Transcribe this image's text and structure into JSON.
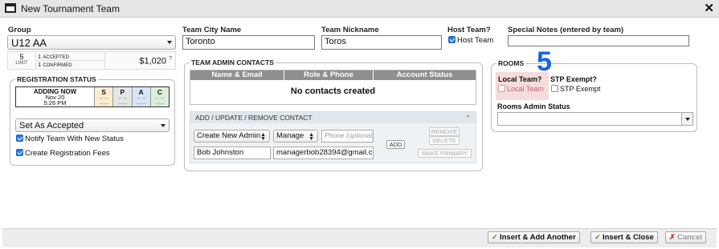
{
  "window": {
    "title": "New Tournament Team"
  },
  "group": {
    "label": "Group",
    "value": "U12 AA",
    "limit_num": "5",
    "limit_label": "LIMIT",
    "accepted_num": "1",
    "accepted_label": "ACCEPTED",
    "confirmed_num": "1",
    "confirmed_label": "CONFIRMED",
    "fee": "$1,020",
    "fee_help": "?"
  },
  "team_city": {
    "label": "Team City Name",
    "value": "Toronto"
  },
  "team_nickname": {
    "label": "Team Nickname",
    "value": "Toros"
  },
  "host_team": {
    "label": "Host Team?",
    "checkbox_label": "Host Team",
    "checked": true
  },
  "special_notes": {
    "label": "Special Notes (entered by team)",
    "value": ""
  },
  "registration": {
    "legend": "REGISTRATION STATUS",
    "adding_now": "ADDING NOW",
    "date": "Nov 20",
    "time": "5:26 PM",
    "status_cols": [
      {
        "letter": "S",
        "val1": "-- --",
        "val2": "--:--",
        "bg": "#fbecd2"
      },
      {
        "letter": "P",
        "val1": "-- --",
        "val2": "--:--",
        "bg": "#e6e6e6"
      },
      {
        "letter": "A",
        "val1": "-- --",
        "val2": "--:--",
        "bg": "#d6e6f6"
      },
      {
        "letter": "C",
        "val1": "-- --",
        "val2": "--:--",
        "bg": "#dcefdc"
      }
    ],
    "status_select": "Set As Accepted",
    "notify_label": "Notify Team With New Status",
    "fees_label": "Create Registration Fees"
  },
  "admin_contacts": {
    "legend": "TEAM ADMIN CONTACTS",
    "columns": [
      "Name & Email",
      "Role & Phone",
      "Account Status"
    ],
    "empty_message": "No contacts created",
    "panel_title": "ADD / UPDATE / REMOVE CONTACT",
    "panel_collapse": "-",
    "create_select": "Create New Admin",
    "role_select": "Manage",
    "phone_placeholder": "Phone (optional)",
    "name_value": "Bob Johnston",
    "email_value": "managerbob28394@gmail.com",
    "add_label": "ADD",
    "remove_label": "REMOVE",
    "delete_label": "DELETE",
    "make_primary_label": "MAKE PRIMARY"
  },
  "rooms": {
    "legend": "ROOMS",
    "badge": "5",
    "local_team_title": "Local Team?",
    "local_team_label": "Local Team",
    "stp_title": "STP Exempt?",
    "stp_label": "STP Exempt",
    "admin_status_label": "Rooms Admin Status",
    "admin_status_value": ""
  },
  "footer": {
    "insert_add_another": "Insert & Add Another",
    "insert_close": "Insert & Close",
    "cancel": "Cancel"
  },
  "colors": {
    "badge": "#1565e0",
    "local_team_bg": "#f6dcdc",
    "header_bg": "#8f8f8f"
  }
}
